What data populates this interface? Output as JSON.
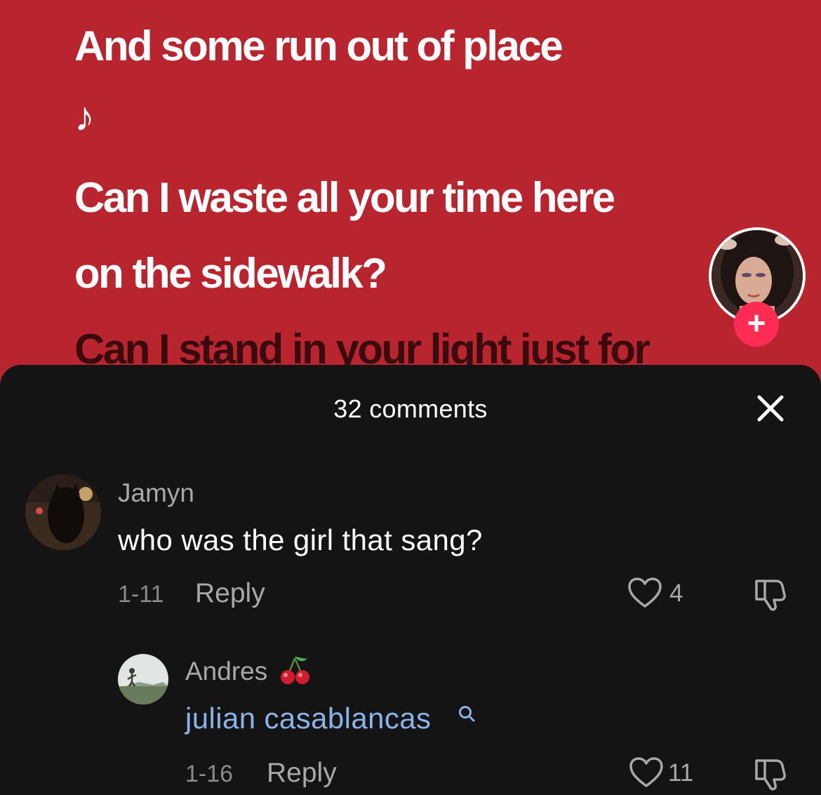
{
  "video": {
    "lyrics": [
      "And some run out of place",
      "♪",
      "Can I waste all your time here",
      "on the sidewalk?",
      "Can I stand in your light just for"
    ],
    "background_color": "#b8252e",
    "follow_button_label": "+"
  },
  "comments_panel": {
    "title": "32 comments",
    "close_icon": "close-icon",
    "comments": [
      {
        "username": "Jamyn",
        "text": "who was the girl that sang?",
        "date": "1-11",
        "reply_label": "Reply",
        "likes": "4"
      }
    ],
    "replies": [
      {
        "username": "Andres",
        "username_emoji": "cherry-icon",
        "text": "julian casablancas",
        "text_icon": "search-icon",
        "date": "1-16",
        "reply_label": "Reply",
        "likes": "11"
      }
    ]
  },
  "colors": {
    "accent_follow": "#fe2c55",
    "sheet_background": "#141414",
    "link_text": "#8ab4e8"
  }
}
